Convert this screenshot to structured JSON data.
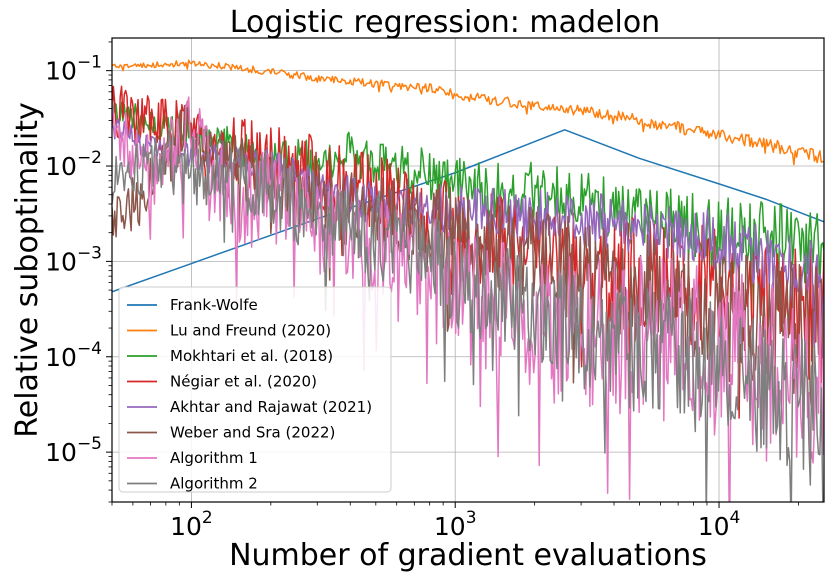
{
  "chart_data": {
    "type": "line",
    "title": "Logistic regression: madelon",
    "xlabel": "Number of gradient evaluations",
    "ylabel": "Relative suboptimality",
    "xscale": "log",
    "yscale": "log",
    "xlim": [
      50,
      25000
    ],
    "ylim": [
      3e-06,
      0.22
    ],
    "grid": true,
    "legend_position": "lower-left",
    "x_ticks": [
      {
        "value": 100,
        "base": "10",
        "exp": "2"
      },
      {
        "value": 1000,
        "base": "10",
        "exp": "3"
      },
      {
        "value": 10000,
        "base": "10",
        "exp": "4"
      }
    ],
    "y_ticks": [
      {
        "value": 0.1,
        "base": "10",
        "exp": "−1"
      },
      {
        "value": 0.01,
        "base": "10",
        "exp": "−2"
      },
      {
        "value": 0.001,
        "base": "10",
        "exp": "−3"
      },
      {
        "value": 0.0001,
        "base": "10",
        "exp": "−4"
      },
      {
        "value": 1e-05,
        "base": "10",
        "exp": "−5"
      }
    ],
    "series": [
      {
        "name": "Frank-Wolfe",
        "color": "#1f77b4",
        "noise": 0,
        "seed": 1,
        "points": [
          [
            50,
            0.00048
          ],
          [
            100,
            0.00095
          ],
          [
            300,
            0.0028
          ],
          [
            1000,
            0.0085
          ],
          [
            2600,
            0.024
          ],
          [
            5000,
            0.012
          ],
          [
            10000,
            0.0065
          ],
          [
            15000,
            0.0045
          ],
          [
            20000,
            0.0033
          ],
          [
            25000,
            0.0026
          ]
        ]
      },
      {
        "name": "Lu and Freund (2020)",
        "color": "#ff7f0e",
        "noise": 0.05,
        "seed": 2,
        "points": [
          [
            50,
            0.11
          ],
          [
            100,
            0.12
          ],
          [
            150,
            0.108
          ],
          [
            200,
            0.097
          ],
          [
            300,
            0.083
          ],
          [
            500,
            0.073
          ],
          [
            800,
            0.066
          ],
          [
            1000,
            0.056
          ],
          [
            2000,
            0.043
          ],
          [
            3000,
            0.038
          ],
          [
            5000,
            0.03
          ],
          [
            10000,
            0.021
          ],
          [
            15000,
            0.017
          ],
          [
            20000,
            0.014
          ],
          [
            25000,
            0.012
          ]
        ]
      },
      {
        "name": "Mokhtari et al. (2018)",
        "color": "#2ca02c",
        "noise": 0.28,
        "seed": 3,
        "points": [
          [
            50,
            0.038
          ],
          [
            70,
            0.03
          ],
          [
            100,
            0.022
          ],
          [
            150,
            0.016
          ],
          [
            200,
            0.012
          ],
          [
            300,
            0.011
          ],
          [
            400,
            0.014
          ],
          [
            500,
            0.01
          ],
          [
            700,
            0.009
          ],
          [
            1000,
            0.007
          ],
          [
            1500,
            0.0055
          ],
          [
            2000,
            0.0055
          ],
          [
            3000,
            0.0045
          ],
          [
            5000,
            0.003
          ],
          [
            7000,
            0.0025
          ],
          [
            10000,
            0.002
          ],
          [
            15000,
            0.0018
          ],
          [
            20000,
            0.0015
          ],
          [
            25000,
            0.0012
          ]
        ]
      },
      {
        "name": "Négiar et al. (2020)",
        "color": "#d62728",
        "noise": 0.5,
        "seed": 4,
        "points": [
          [
            50,
            0.038
          ],
          [
            80,
            0.028
          ],
          [
            100,
            0.018
          ],
          [
            150,
            0.014
          ],
          [
            200,
            0.012
          ],
          [
            300,
            0.008
          ],
          [
            500,
            0.005
          ],
          [
            800,
            0.003
          ],
          [
            1000,
            0.002
          ],
          [
            2000,
            0.0013
          ],
          [
            3000,
            0.0009
          ],
          [
            5000,
            0.0007
          ],
          [
            10000,
            0.0005
          ],
          [
            15000,
            0.0004
          ],
          [
            25000,
            0.00025
          ]
        ]
      },
      {
        "name": "Akhtar and Rajawat (2021)",
        "color": "#9467bd",
        "noise": 0.25,
        "seed": 5,
        "points": [
          [
            50,
            0.026
          ],
          [
            80,
            0.013
          ],
          [
            100,
            0.012
          ],
          [
            150,
            0.013
          ],
          [
            200,
            0.01
          ],
          [
            300,
            0.006
          ],
          [
            500,
            0.004
          ],
          [
            1000,
            0.0035
          ],
          [
            2000,
            0.003
          ],
          [
            3000,
            0.0028
          ],
          [
            5000,
            0.0024
          ],
          [
            10000,
            0.0016
          ],
          [
            15000,
            0.0011
          ],
          [
            20000,
            0.0008
          ],
          [
            25000,
            0.00065
          ]
        ]
      },
      {
        "name": "Weber and Sra (2022)",
        "color": "#8c564b",
        "noise": 0.5,
        "seed": 6,
        "points": [
          [
            50,
            0.003
          ],
          [
            60,
            0.004
          ],
          [
            80,
            0.011
          ],
          [
            100,
            0.03
          ],
          [
            120,
            0.012
          ],
          [
            150,
            0.009
          ],
          [
            200,
            0.0065
          ],
          [
            300,
            0.0045
          ],
          [
            500,
            0.003
          ],
          [
            1000,
            0.002
          ],
          [
            2000,
            0.0012
          ],
          [
            3000,
            0.0008
          ],
          [
            5000,
            0.0005
          ],
          [
            10000,
            0.0003
          ],
          [
            25000,
            0.00018
          ]
        ]
      },
      {
        "name": "Algorithm 1",
        "color": "#e377c2",
        "noise": 0.7,
        "seed": 7,
        "points": [
          [
            50,
            0.025
          ],
          [
            70,
            0.008
          ],
          [
            100,
            0.02
          ],
          [
            150,
            0.004
          ],
          [
            200,
            0.005
          ],
          [
            300,
            0.002
          ],
          [
            500,
            0.0012
          ],
          [
            800,
            0.0007
          ],
          [
            1000,
            0.0004
          ],
          [
            2000,
            0.00025
          ],
          [
            3000,
            0.0002
          ],
          [
            5000,
            0.00016
          ],
          [
            10000,
            0.00012
          ],
          [
            15000,
            0.0001
          ],
          [
            25000,
            6e-05
          ]
        ]
      },
      {
        "name": "Algorithm 2",
        "color": "#7f7f7f",
        "noise": 0.55,
        "seed": 8,
        "points": [
          [
            50,
            0.007
          ],
          [
            80,
            0.012
          ],
          [
            100,
            0.009
          ],
          [
            150,
            0.008
          ],
          [
            200,
            0.006
          ],
          [
            300,
            0.003
          ],
          [
            500,
            0.002
          ],
          [
            1000,
            0.0007
          ],
          [
            2000,
            0.0003
          ],
          [
            3000,
            0.00018
          ],
          [
            5000,
            0.00012
          ],
          [
            10000,
            7e-05
          ],
          [
            15000,
            4e-05
          ],
          [
            25000,
            2e-05
          ]
        ]
      }
    ]
  }
}
